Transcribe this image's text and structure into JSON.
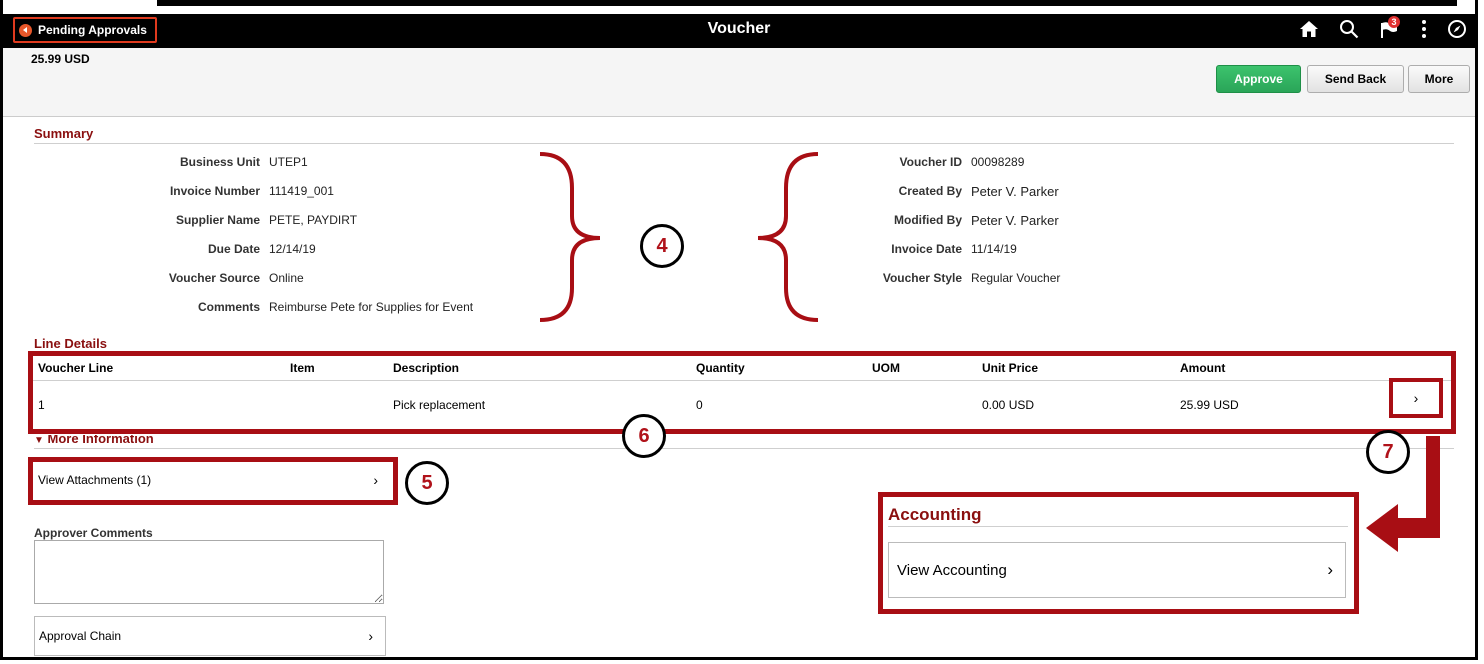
{
  "header": {
    "back_label": "Pending Approvals",
    "title": "Voucher",
    "notification_count": "3"
  },
  "amount": "25.99  USD",
  "actions": {
    "approve": "Approve",
    "send_back": "Send Back",
    "more": "More"
  },
  "summary": {
    "title": "Summary",
    "left": [
      {
        "label": "Business Unit",
        "value": "UTEP1"
      },
      {
        "label": "Invoice Number",
        "value": "111419_001"
      },
      {
        "label": "Supplier Name",
        "value": "PETE, PAYDIRT"
      },
      {
        "label": "Due Date",
        "value": "12/14/19"
      },
      {
        "label": "Voucher Source",
        "value": "Online"
      },
      {
        "label": "Comments",
        "value": "Reimburse Pete for Supplies for Event"
      }
    ],
    "right": [
      {
        "label": "Voucher ID",
        "value": "00098289"
      },
      {
        "label": "Created By",
        "value": "Peter V. Parker"
      },
      {
        "label": "Modified By",
        "value": "Peter V. Parker"
      },
      {
        "label": "Invoice Date",
        "value": "11/14/19"
      },
      {
        "label": "Voucher Style",
        "value": "Regular Voucher"
      }
    ]
  },
  "line_details": {
    "title": "Line Details",
    "columns": [
      "Voucher Line",
      "Item",
      "Description",
      "Quantity",
      "UOM",
      "Unit Price",
      "Amount"
    ],
    "rows": [
      [
        "1",
        "",
        "Pick replacement",
        "0",
        "",
        "0.00 USD",
        "25.99 USD"
      ]
    ]
  },
  "more_info": {
    "title": "More Information",
    "view_attachments": "View Attachments (1)",
    "approver_comments_label": "Approver Comments",
    "approver_comments_value": "",
    "approval_chain": "Approval Chain"
  },
  "accounting": {
    "title": "Accounting",
    "view_accounting": "View Accounting"
  },
  "callouts": {
    "c4": "4",
    "c5": "5",
    "c6": "6",
    "c7": "7"
  },
  "colors": {
    "annotation_red": "#a80e14",
    "section_title": "#8a0f0f",
    "approve_green": "#2aa558"
  }
}
